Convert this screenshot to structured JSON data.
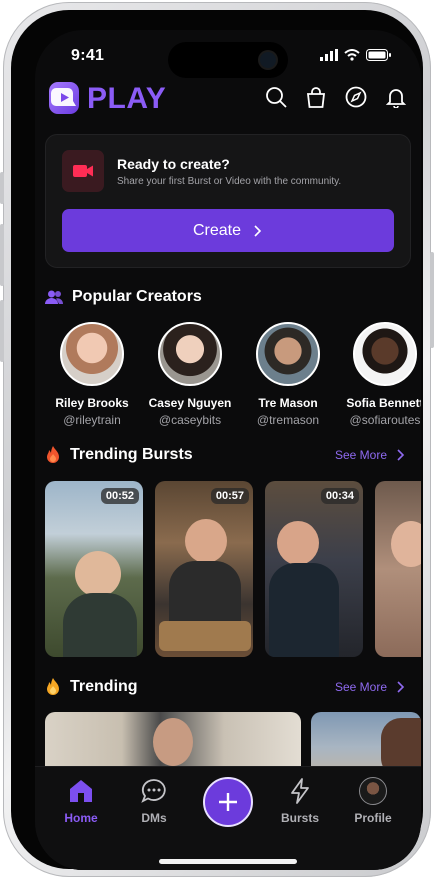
{
  "status_bar": {
    "time": "9:41"
  },
  "app": {
    "name": "PLAY"
  },
  "create_card": {
    "title": "Ready to create?",
    "subtitle": "Share your first Burst or Video with the community.",
    "button_label": "Create"
  },
  "popular_creators": {
    "title": "Popular Creators",
    "items": [
      {
        "name": "Riley Brooks",
        "handle": "@rileytrain"
      },
      {
        "name": "Casey Nguyen",
        "handle": "@caseybits"
      },
      {
        "name": "Tre Mason",
        "handle": "@tremason"
      },
      {
        "name": "Sofia Bennett",
        "handle": "@sofiaroutes"
      }
    ]
  },
  "trending_bursts": {
    "title": "Trending Bursts",
    "see_more": "See More",
    "items": [
      {
        "duration": "00:52"
      },
      {
        "duration": "00:57"
      },
      {
        "duration": "00:34"
      },
      {
        "duration": ""
      }
    ]
  },
  "trending": {
    "title": "Trending",
    "see_more": "See More"
  },
  "tab_bar": {
    "items": [
      {
        "label": "Home",
        "active": true
      },
      {
        "label": "DMs",
        "active": false
      },
      {
        "label": "",
        "active": false
      },
      {
        "label": "Bursts",
        "active": false
      },
      {
        "label": "Profile",
        "active": false
      }
    ]
  },
  "colors": {
    "accent": "#6c3bdc",
    "accent_text": "#8f6af0",
    "background": "#0b0b0c",
    "card": "#151516",
    "fire": "#f0552d"
  },
  "icons": {
    "header": [
      "search-icon",
      "shopping-bag-icon",
      "compass-icon",
      "bell-icon"
    ],
    "tabs": [
      "home-icon",
      "chat-icon",
      "plus-icon",
      "lightning-icon",
      "avatar-icon"
    ]
  }
}
